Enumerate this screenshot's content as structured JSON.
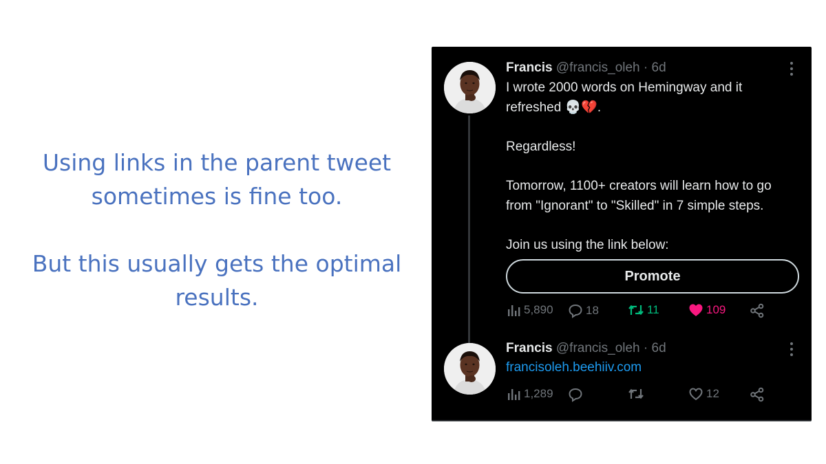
{
  "caption": {
    "line1": "Using links in the parent tweet sometimes is fine too.",
    "line2": "But this usually gets the optimal results."
  },
  "tweet1": {
    "name": "Francis",
    "handle": "@francis_oleh",
    "sep": "·",
    "time": "6d",
    "text": {
      "l1": "I wrote 2000 words on Hemingway and it refreshed 💀💔.",
      "l2": "Regardless!",
      "l3": "Tomorrow, 1100+ creators will learn how to go from \"Ignorant\" to \"Skilled\" in 7 simple steps.",
      "l4": "Join us using the link below:"
    },
    "button_label": "Promote",
    "stats": {
      "views": "5,890",
      "replies": "18",
      "retweets": "11",
      "likes": "109"
    },
    "colors": {
      "retweet": "#00ba7c",
      "like": "#f91880"
    }
  },
  "tweet2": {
    "name": "Francis",
    "handle": "@francis_oleh",
    "sep": "·",
    "time": "6d",
    "link": "francisoleh.beehiiv.com",
    "stats": {
      "views": "1,289",
      "likes": "12"
    }
  }
}
